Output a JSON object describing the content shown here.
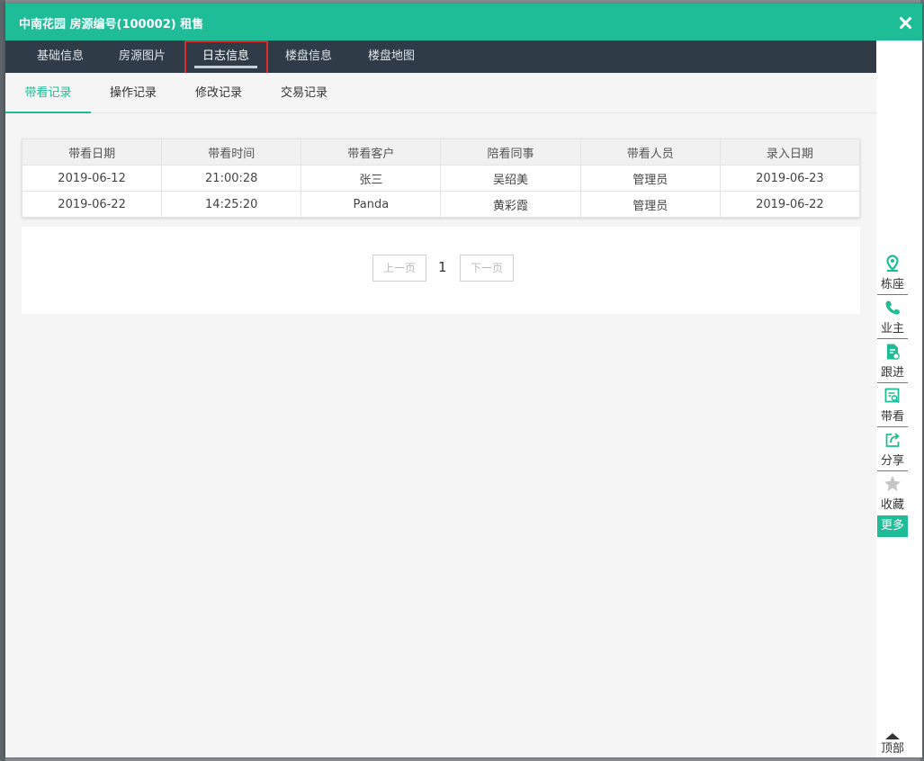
{
  "dialog": {
    "title": "中南花园 房源编号(100002) 租售"
  },
  "tabs": [
    {
      "label": "基础信息"
    },
    {
      "label": "房源图片"
    },
    {
      "label": "日志信息",
      "active": true
    },
    {
      "label": "楼盘信息"
    },
    {
      "label": "楼盘地图"
    }
  ],
  "subtabs": [
    {
      "label": "带看记录",
      "active": true
    },
    {
      "label": "操作记录"
    },
    {
      "label": "修改记录"
    },
    {
      "label": "交易记录"
    }
  ],
  "table": {
    "headers": [
      "带看日期",
      "带看时间",
      "带看客户",
      "陪看同事",
      "带看人员",
      "录入日期"
    ],
    "rows": [
      [
        "2019-06-12",
        "21:00:28",
        "张三",
        "吴绍美",
        "管理员",
        "2019-06-23"
      ],
      [
        "2019-06-22",
        "14:25:20",
        "Panda",
        "黄彩霞",
        "管理员",
        "2019-06-22"
      ]
    ]
  },
  "pager": {
    "prev": "上一页",
    "current": "1",
    "next": "下一页"
  },
  "sidebar": {
    "items": [
      {
        "label": "栋座",
        "icon": "location-pin-icon"
      },
      {
        "label": "业主",
        "icon": "phone-icon"
      },
      {
        "label": "跟进",
        "icon": "follow-doc-icon"
      },
      {
        "label": "带看",
        "icon": "view-search-icon"
      },
      {
        "label": "分享",
        "icon": "share-icon"
      },
      {
        "label": "收藏",
        "icon": "star-icon"
      }
    ],
    "more": "更多",
    "top": "顶部"
  },
  "colors": {
    "accent": "#1ebc97",
    "tabbar": "#2f3c48",
    "highlight": "#e02b2b"
  }
}
